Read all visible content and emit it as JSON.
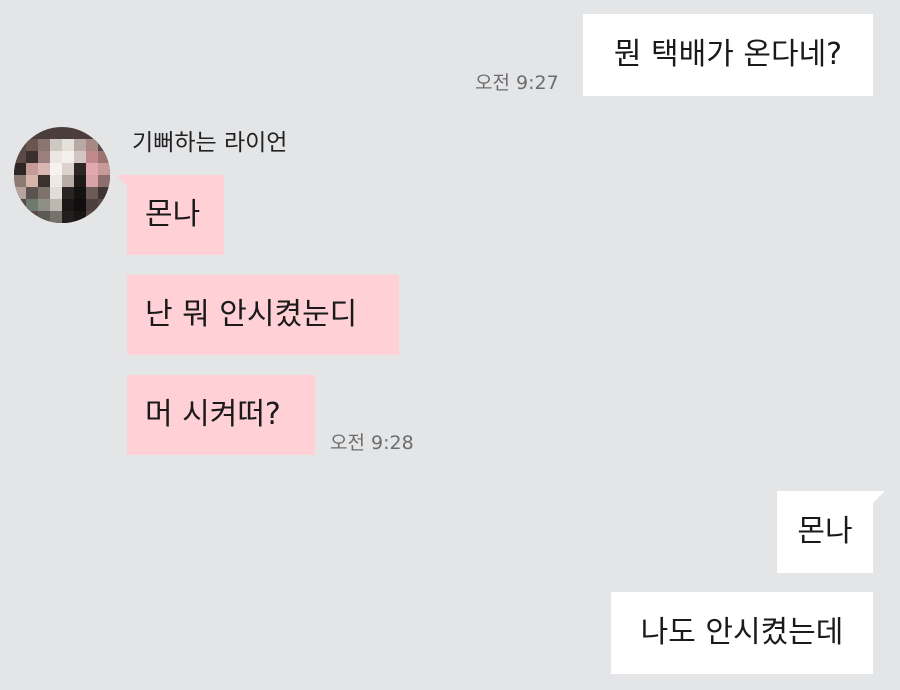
{
  "conversation": {
    "contact_name": "기뻐하는 라이언",
    "messages": [
      {
        "sender": "me",
        "text": "뭔 택배가 온다네?",
        "time": "오전 9:27"
      },
      {
        "sender": "contact",
        "text": "몬나"
      },
      {
        "sender": "contact",
        "text": "난 뭐 안시켰눈디"
      },
      {
        "sender": "contact",
        "text": "머 시켜떠?",
        "time": "오전 9:28"
      },
      {
        "sender": "me",
        "text": "몬나"
      },
      {
        "sender": "me",
        "text": "나도 안시켰는데"
      }
    ]
  },
  "colors": {
    "background": "#e4e5e7",
    "outgoing_bubble": "#ffffff",
    "incoming_bubble": "#ffd1d6",
    "timestamp": "#6d6d6d"
  },
  "icons": {
    "avatar": "pixelated-profile-photo"
  }
}
